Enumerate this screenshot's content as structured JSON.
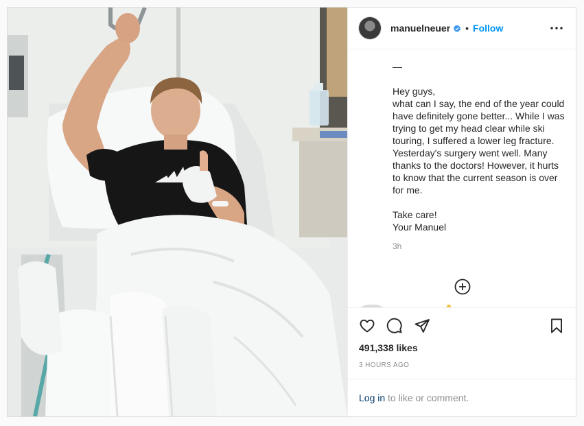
{
  "post": {
    "username": "manuelneuer",
    "verified": true,
    "follow_label": "Follow",
    "separator": "•",
    "caption_dash": "—",
    "caption": "Hey guys,\nwhat can I say, the end of the year could have definitely gone better... While I was trying to get my head clear while ski touring, I suffered a lower leg fracture. Yesterday's surgery went well. Many thanks to the doctors! However, it hurts to know that the current season is over for me.\n\nTake care!\nYour Manuel",
    "time_ago": "3h",
    "likes": "491,338 likes",
    "date": "3 HOURS AGO",
    "login_link": "Log in",
    "login_rest": " to like or comment."
  },
  "icons": {
    "more": "more-options-icon",
    "verified": "verified-badge-icon",
    "load_more": "load-more-comments-icon",
    "like": "heart-icon",
    "comment": "comment-bubble-icon",
    "share": "paper-plane-icon",
    "save": "bookmark-icon"
  },
  "colors": {
    "follow": "#0095f6",
    "link": "#00376b",
    "muted": "#8e8e8e",
    "text": "#262626",
    "border": "#dbdbdb"
  }
}
